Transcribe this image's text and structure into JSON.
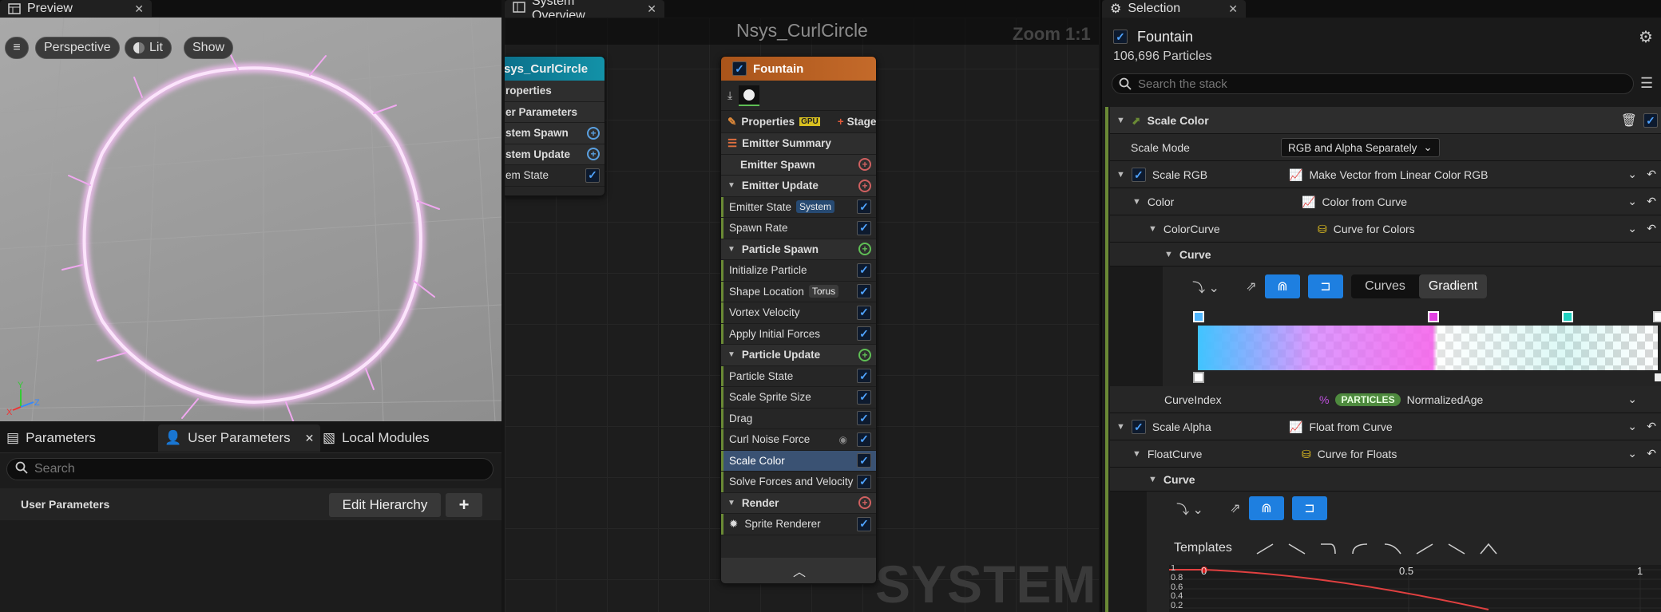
{
  "preview_tab": {
    "label": "Preview"
  },
  "viewport": {
    "menu": "≡",
    "perspective": "Perspective",
    "lit": "Lit",
    "show": "Show"
  },
  "params_panel": {
    "tabs": [
      "Parameters",
      "User Parameters",
      "Local Modules"
    ],
    "search_placeholder": "Search",
    "section": "User Parameters",
    "edit_hierarchy": "Edit Hierarchy",
    "add": "+"
  },
  "system_tab": {
    "label": "System Overview"
  },
  "graph": {
    "title": "Nsys_CurlCircle",
    "zoom": "Zoom 1:1",
    "watermark": "SYSTEM",
    "system_node": {
      "title": "sys_CurlCircle",
      "rows": [
        "roperties",
        "er Parameters",
        "stem Spawn",
        "stem Update",
        "em State"
      ]
    },
    "emitter_node": {
      "title": "Fountain",
      "properties": "Properties",
      "gpu_badge": "GPU",
      "stage": "Stage",
      "rows": [
        {
          "label": "Emitter Summary",
          "type": "section",
          "icon": "list"
        },
        {
          "label": "Emitter Spawn",
          "type": "group",
          "add": true
        },
        {
          "label": "Emitter Update",
          "type": "group",
          "add": true,
          "collapse": true
        },
        {
          "label": "Emitter State",
          "tag": "System",
          "check": true
        },
        {
          "label": "Spawn Rate",
          "check": true
        },
        {
          "label": "Particle Spawn",
          "type": "group",
          "add": true,
          "collapse": true,
          "color": "#5fbf55"
        },
        {
          "label": "Initialize Particle",
          "check": true
        },
        {
          "label": "Shape Location",
          "tag": "Torus",
          "check": true
        },
        {
          "label": "Vortex Velocity",
          "check": true
        },
        {
          "label": "Apply Initial Forces",
          "check": true
        },
        {
          "label": "Particle Update",
          "type": "group",
          "add": true,
          "collapse": true,
          "color": "#5fbf55"
        },
        {
          "label": "Particle State",
          "check": true
        },
        {
          "label": "Scale Sprite Size",
          "check": true
        },
        {
          "label": "Drag",
          "check": true
        },
        {
          "label": "Curl Noise Force",
          "check": true,
          "eye": true
        },
        {
          "label": "Scale Color",
          "check": true,
          "selected": true
        },
        {
          "label": "Solve Forces and Velocity",
          "check": true
        },
        {
          "label": "Render",
          "type": "group",
          "add": true,
          "collapse": true,
          "color": "#d06060"
        },
        {
          "label": "Sprite Renderer",
          "check": true,
          "icon": "sprite"
        }
      ]
    }
  },
  "selection": {
    "tab": "Selection",
    "emitter": "Fountain",
    "particles": "106,696 Particles",
    "search_placeholder": "Search the stack",
    "module": "Scale Color",
    "scale_mode_label": "Scale Mode",
    "scale_mode_value": "RGB and Alpha Separately",
    "scale_rgb": "Scale RGB",
    "scale_rgb_value": "Make Vector from Linear Color RGB",
    "color": "Color",
    "color_value": "Color from Curve",
    "colorcurve": "ColorCurve",
    "colorcurve_value": "Curve for Colors",
    "curve": "Curve",
    "curves_btn": "Curves",
    "gradient_btn": "Gradient",
    "curveindex": "CurveIndex",
    "curveindex_badge": "PARTICLES",
    "curveindex_value": "NormalizedAge",
    "scale_alpha": "Scale Alpha",
    "scale_alpha_value": "Float from Curve",
    "floatcurve": "FloatCurve",
    "floatcurve_value": "Curve for Floats",
    "curve2": "Curve",
    "templates": "Templates",
    "graph_ticks_x": [
      "0",
      "0.5",
      "1"
    ],
    "graph_ticks_y": [
      "1",
      "0.8",
      "0.6",
      "0.4",
      "0.2"
    ],
    "accent": "#1e7fe0"
  }
}
